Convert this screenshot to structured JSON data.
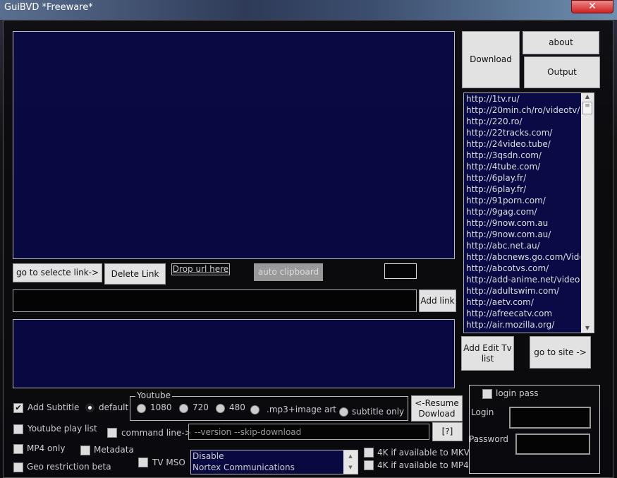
{
  "window": {
    "title": "GuiBVD *Freeware*",
    "close": "✕"
  },
  "buttons": {
    "download": "Download",
    "about": "about",
    "output": "Output",
    "go_to_link": "go to selecte link->",
    "delete_link": "Delete Link",
    "drop_url": "Drop url here",
    "auto_clipboard": "auto clipboard",
    "add_link": "Add link",
    "add_edit_tv": "Add Edit Tv list",
    "go_to_site": "go to site ->",
    "resume": "<-Resume Dowload",
    "help": "[?]"
  },
  "sites": [
    "http://1tv.ru/",
    "http://20min.ch/ro/videotv/",
    "http://220.ro/",
    "http://22tracks.com/",
    "http://24video.tube/",
    "http://3qsdn.com/",
    "http://4tube.com/",
    "http://6play.fr/",
    "http://6play.fr/",
    "http://91porn.com/",
    "http://9gag.com/",
    "http://9now.com.au",
    "http://9now.com.au/",
    "http://abc.net.au/",
    "http://abcnews.go.com/Video",
    "http://abcotvs.com/",
    "http://add-anime.net/videos",
    "http://adultswim.com/",
    "http://aetv.com/",
    "http://afreecatv.com",
    "http://air.mozilla.org/"
  ],
  "options": {
    "add_subtitle": "Add Subtitle",
    "add_subtitle_checked": true,
    "default": "default",
    "youtube_group": "Youtube",
    "r1080": "1080",
    "r720": "720",
    "r480": "480",
    "mp3": ".mp3+image art",
    "subtitle_only": "subtitle only",
    "youtube_playlist": "Youtube play list",
    "command_line": "command line->",
    "command_value": "--version --skip-download",
    "mp4_only": "MP4 only",
    "metadata": "Metadata",
    "geo": "Geo restriction beta",
    "tv_mso": "TV MSO",
    "mso_list": [
      "Disable",
      "Nortex Communications"
    ],
    "mkv4k": "4K if available to MKV",
    "mp44k": "4K if available to MP4"
  },
  "login": {
    "login_pass": "login pass",
    "login_label": "Login",
    "password_label": "Password"
  }
}
